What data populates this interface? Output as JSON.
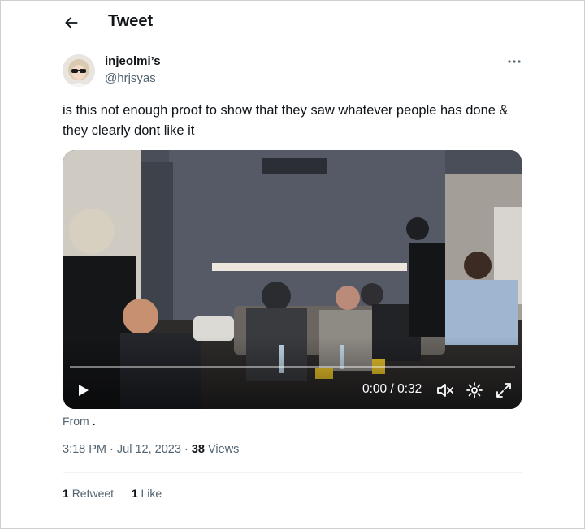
{
  "header": {
    "title": "Tweet",
    "back_icon": "arrow-left-icon"
  },
  "author": {
    "display_name": "injeolmi’s",
    "handle": "@hrjsyas",
    "more_icon": "more-dots-icon"
  },
  "tweet": {
    "text": "is this not enough proof to show that they saw whatever people has done & they clearly dont like it"
  },
  "video": {
    "time": "0:00 / 0:32",
    "progress": 0,
    "icons": [
      "play-icon",
      "volume-muted-icon",
      "gear-icon",
      "fullscreen-icon"
    ]
  },
  "source": {
    "label": "From",
    "value": "."
  },
  "meta": {
    "time": "3:18 PM",
    "date": "Jul 12, 2023",
    "sep": "·",
    "views_count": "38",
    "views_label": "Views"
  },
  "stats": {
    "retweet_count": "1",
    "retweet_label": "Retweet",
    "like_count": "1",
    "like_label": "Like"
  },
  "colors": {
    "text": "#0f1419",
    "secondary": "#536471",
    "divider": "#eff3f4"
  }
}
